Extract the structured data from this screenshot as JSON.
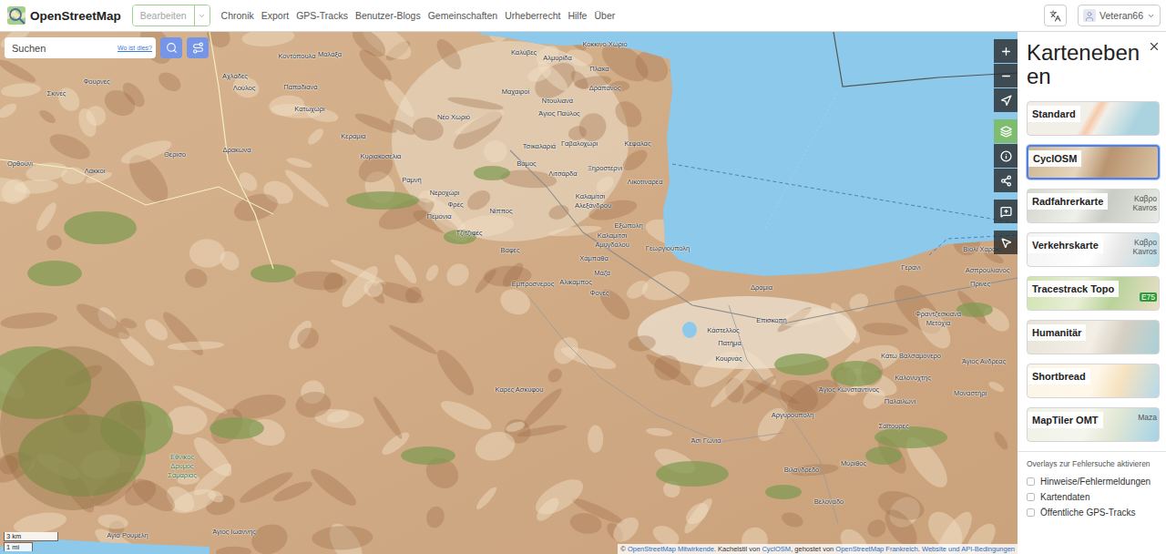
{
  "header": {
    "logo": "OpenStreetMap",
    "edit_button": {
      "label": "Bearbeiten",
      "disabled": true
    },
    "nav": [
      "Chronik",
      "Export",
      "GPS-Tracks",
      "Benutzer-Blogs",
      "Gemeinschaften",
      "Urheberrecht",
      "Hilfe",
      "Über"
    ],
    "user": {
      "name": "Veteran66"
    }
  },
  "search": {
    "placeholder": "Suchen",
    "where_link": "Wo ist dies?"
  },
  "map": {
    "labels": [
      {
        "text": "Καλύβες",
        "kind": "place"
      },
      {
        "text": "Αλμυρίδα",
        "kind": "place"
      },
      {
        "text": "Κόκκινο Χωριό",
        "kind": "place"
      },
      {
        "text": "Πλάκα",
        "kind": "place"
      },
      {
        "text": "Δράπανος",
        "kind": "place"
      },
      {
        "text": "Κοντόπουλα",
        "kind": "place"
      },
      {
        "text": "Μαλάξα",
        "kind": "place"
      },
      {
        "text": "Αχλάδες",
        "kind": "place"
      },
      {
        "text": "Λούλος",
        "kind": "place"
      },
      {
        "text": "Παπαδιανά",
        "kind": "place"
      },
      {
        "text": "Κατωχώρι",
        "kind": "place"
      },
      {
        "text": "Φουρνές",
        "kind": "place"
      },
      {
        "text": "Σκινές",
        "kind": "place"
      },
      {
        "text": "Δρακώνα",
        "kind": "place"
      },
      {
        "text": "Θέρισο",
        "kind": "place"
      },
      {
        "text": "Ορθούνι",
        "kind": "place"
      },
      {
        "text": "Λάκκοι",
        "kind": "place"
      },
      {
        "text": "Κεράμια",
        "kind": "place"
      },
      {
        "text": "Κυριακοσέλια",
        "kind": "place"
      },
      {
        "text": "Ραμνή",
        "kind": "place"
      },
      {
        "text": "Νεροχώρι",
        "kind": "place"
      },
      {
        "text": "Φρές",
        "kind": "place"
      },
      {
        "text": "Πεμόνια",
        "kind": "place"
      },
      {
        "text": "Τζιτζιφές",
        "kind": "place"
      },
      {
        "text": "Νίππος",
        "kind": "place"
      },
      {
        "text": "Βαφές",
        "kind": "place"
      },
      {
        "text": "Εμπροσνέρος",
        "kind": "place"
      },
      {
        "text": "Αλίκαμπος",
        "kind": "place"
      },
      {
        "text": "Φονές",
        "kind": "place"
      },
      {
        "text": "Μάζα",
        "kind": "place"
      },
      {
        "text": "Χάμπαθα",
        "kind": "place"
      },
      {
        "text": "Καλαμίτσι",
        "kind": "place"
      },
      {
        "text": "Αλεξάνδρου",
        "kind": "place"
      },
      {
        "text": "Εξώπολη",
        "kind": "place"
      },
      {
        "text": "Καλαμίτσι",
        "kind": "place"
      },
      {
        "text": "Αμυγδάλου",
        "kind": "place"
      },
      {
        "text": "Βάμος",
        "kind": "place"
      },
      {
        "text": "Τσικαλαριά",
        "kind": "place"
      },
      {
        "text": "Γαβαλοχώρι",
        "kind": "place"
      },
      {
        "text": "Κεφαλάς",
        "kind": "place"
      },
      {
        "text": "Λιτσάρδα",
        "kind": "place"
      },
      {
        "text": "Ξηροστέρνι",
        "kind": "place"
      },
      {
        "text": "Λικοτιναρέα",
        "kind": "place"
      },
      {
        "text": "Νέο Χωριό",
        "kind": "place"
      },
      {
        "text": "Μαχαιροί",
        "kind": "place"
      },
      {
        "text": "Ντουλιανά",
        "kind": "place"
      },
      {
        "text": "Άγιος Παύλος",
        "kind": "place"
      },
      {
        "text": "Γεωργιούπολη",
        "kind": "place"
      },
      {
        "text": "Δράμια",
        "kind": "place"
      },
      {
        "text": "Επισκοπή",
        "kind": "place"
      },
      {
        "text": "Κάστελλος",
        "kind": "place"
      },
      {
        "text": "Πατήμα",
        "kind": "place"
      },
      {
        "text": "Κουρνάς",
        "kind": "place"
      },
      {
        "text": "Βιολί Χαράκι",
        "kind": "place"
      },
      {
        "text": "Ασπρουλιανός",
        "kind": "place"
      },
      {
        "text": "Γεράνι",
        "kind": "place"
      },
      {
        "text": "Πρινές",
        "kind": "place"
      },
      {
        "text": "Φραντζεσκιανά",
        "kind": "place"
      },
      {
        "text": "Μετόχια",
        "kind": "place"
      },
      {
        "text": "Κάτω Βαλσαμόνερο",
        "kind": "place"
      },
      {
        "text": "Άγιος Ανδρέας",
        "kind": "place"
      },
      {
        "text": "Καλονύχτης",
        "kind": "place"
      },
      {
        "text": "Άγιος Κωνσταντίνος",
        "kind": "place"
      },
      {
        "text": "Παλαιλώνι",
        "kind": "place"
      },
      {
        "text": "Μοναστήρι",
        "kind": "place"
      },
      {
        "text": "Αργυρούπολη",
        "kind": "place"
      },
      {
        "text": "Σαϊτούρες",
        "kind": "place"
      },
      {
        "text": "Καρές Ασκύφου",
        "kind": "place"
      },
      {
        "text": "Άσι Γωνιά",
        "kind": "place"
      },
      {
        "text": "Βιλανδρέδο",
        "kind": "place"
      },
      {
        "text": "Μύριθος",
        "kind": "place"
      },
      {
        "text": "Βελονάδο",
        "kind": "place"
      },
      {
        "text": "Άγιος Ιωάννης",
        "kind": "place"
      },
      {
        "text": "Αγία Ρουμέλη",
        "kind": "place"
      },
      {
        "text": "Εθνικός",
        "kind": "park"
      },
      {
        "text": "Δρυμός",
        "kind": "park"
      },
      {
        "text": "Σαμαριάς",
        "kind": "park"
      }
    ],
    "scale": {
      "metric": "3 km",
      "imperial": "1 mi"
    },
    "attribution": [
      {
        "text": "© ",
        "link": false
      },
      {
        "text": "OpenStreetMap Mitwirkende",
        "link": true
      },
      {
        "text": ". Kachelstil von ",
        "link": false
      },
      {
        "text": "CyclOSM",
        "link": true
      },
      {
        "text": ", gehostet von ",
        "link": false
      },
      {
        "text": "OpenStreetMap Frankreich",
        "link": true
      },
      {
        "text": ". ",
        "link": false
      },
      {
        "text": "Website und API-Bedingungen",
        "link": true
      }
    ]
  },
  "map_controls": [
    [
      {
        "kind": "zoom-in",
        "active": false
      },
      {
        "kind": "zoom-out",
        "active": false
      },
      {
        "kind": "locate",
        "active": false
      }
    ],
    [
      {
        "kind": "layers",
        "active": true
      },
      {
        "kind": "info",
        "active": false
      },
      {
        "kind": "share",
        "active": false
      }
    ],
    [
      {
        "kind": "note",
        "active": false
      }
    ],
    [
      {
        "kind": "query",
        "active": false
      }
    ]
  ],
  "layers_panel": {
    "title": "Kartenebenen",
    "layers": [
      {
        "label": "Standard",
        "selected": false,
        "thumb_labels": []
      },
      {
        "label": "CyclOSM",
        "selected": true,
        "thumb_labels": []
      },
      {
        "label": "Radfahrerkarte",
        "selected": false,
        "thumb_labels": [
          "Καβρο",
          "Kavros"
        ]
      },
      {
        "label": "Verkehrskarte",
        "selected": false,
        "thumb_labels": [
          "Καβρο",
          "Kavros"
        ]
      },
      {
        "label": "Tracestrack Topo",
        "selected": false,
        "thumb_labels": [
          "E75"
        ]
      },
      {
        "label": "Humanitär",
        "selected": false,
        "thumb_labels": []
      },
      {
        "label": "Shortbread",
        "selected": false,
        "thumb_labels": []
      },
      {
        "label": "MapTiler OMT",
        "selected": false,
        "thumb_labels": [
          "Maza"
        ]
      }
    ],
    "overlays": {
      "title": "Overlays zur Fehlersuche aktivieren",
      "items": [
        {
          "label": "Hinweise/Fehlermeldungen",
          "checked": false
        },
        {
          "label": "Kartendaten",
          "checked": false
        },
        {
          "label": "Öffentliche GPS-Tracks",
          "checked": false
        }
      ]
    }
  }
}
